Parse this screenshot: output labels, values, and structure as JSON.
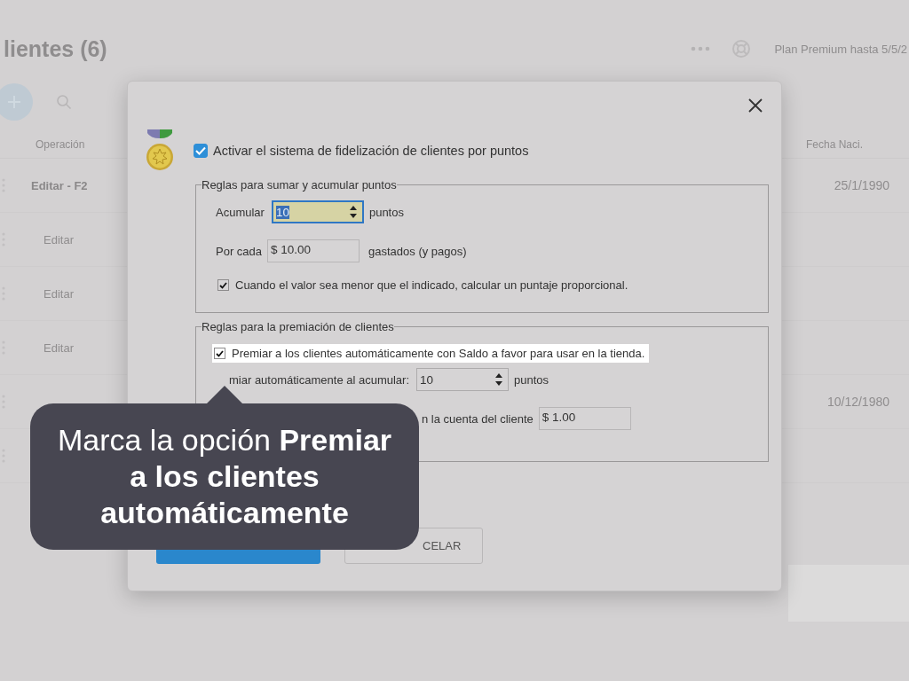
{
  "app": {
    "title": "lientes (6)",
    "plan": "Plan Premium hasta 5/5/2",
    "columns": [
      "Operación",
      "Fecha Naci."
    ],
    "rows": [
      {
        "operation": "Editar - F2",
        "date": "25/1/1990"
      },
      {
        "operation": "Editar"
      },
      {
        "operation": "Editar"
      },
      {
        "operation": "Editar"
      },
      {
        "date": "10/12/1980"
      },
      {}
    ]
  },
  "dialog": {
    "enable": {
      "label": "Activar el sistema de fidelización de clientes por puntos",
      "checked": true
    },
    "groups": [
      {
        "title": "Reglas para sumar y acumular puntos",
        "rows": [
          {
            "kind": "spinner",
            "label": "Acumular",
            "value": "10",
            "unit": "puntos",
            "focused": true
          },
          {
            "kind": "money",
            "label": "Por cada",
            "value": "$ 10.00",
            "unit": "gastados (y pagos)"
          },
          {
            "kind": "check",
            "label": "Cuando el valor sea menor que el indicado, calcular un puntaje proporcional.",
            "checked": true,
            "highlighted": false
          }
        ]
      },
      {
        "title": "Reglas para la premiación de clientes",
        "rows": [
          {
            "kind": "check",
            "label": "Premiar a los clientes automáticamente con Saldo a favor para usar en la tienda.",
            "checked": true,
            "highlighted": true
          },
          {
            "kind": "spinner",
            "label": "miar automáticamente al acumular:",
            "value": "10",
            "unit": "puntos",
            "focused": false
          },
          {
            "kind": "money",
            "label": "n la cuenta del cliente",
            "value": "$ 1.00"
          }
        ]
      }
    ],
    "buttons": [
      {
        "kind": "primary"
      },
      {
        "kind": "secondary",
        "label": "CELAR"
      }
    ]
  },
  "tooltip": {
    "text": "Marca la opción **Premiar a los clientes automáticamente**"
  }
}
